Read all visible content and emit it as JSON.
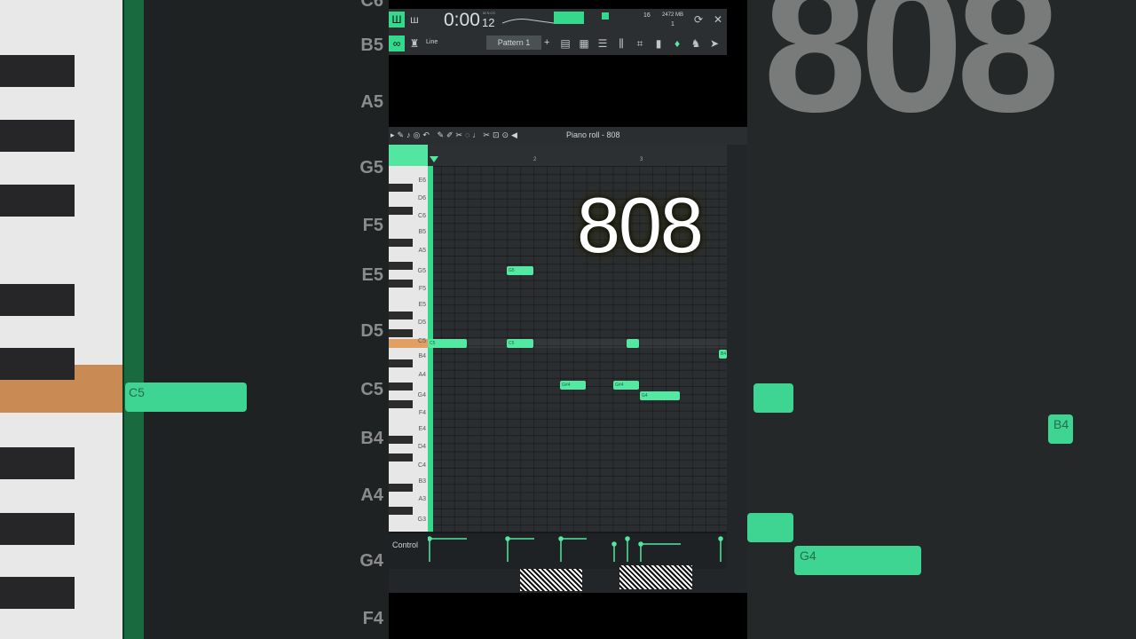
{
  "background_left": {
    "key_labels": [
      "C6",
      "B5",
      "A5",
      "G5",
      "F5",
      "E5",
      "D5",
      "C5",
      "B4",
      "A4",
      "G4",
      "F4"
    ],
    "note_label": "C5"
  },
  "background_right": {
    "big_text": "808",
    "notes": [
      "B4",
      "G4"
    ]
  },
  "topbar": {
    "time": "0:00",
    "time_small": "12",
    "time_unit": "M:S:CS",
    "cpu_value": "16",
    "memory": "2472 MB",
    "poly": "1",
    "pattern_label": "Pattern 1",
    "snap_label": "Line",
    "tool_icons": [
      "mixer-icon",
      "channel-rack-icon",
      "playlist-icon",
      "piano-roll-icon",
      "browser-icon",
      "plugin-icon",
      "microphone-icon",
      "help-icon"
    ]
  },
  "piano_roll": {
    "title": "Piano roll - 808",
    "bar_numbers": [
      "2",
      "3"
    ],
    "key_labels": [
      "E6",
      "D6",
      "C6",
      "B5",
      "A5",
      "G5",
      "F5",
      "E5",
      "D5",
      "C5",
      "B4",
      "A4",
      "G4",
      "F4",
      "E4",
      "D4",
      "C4",
      "B3",
      "A3",
      "G3"
    ],
    "highlighted_key": "C5",
    "notes": [
      {
        "label": "C5"
      },
      {
        "label": "G5"
      },
      {
        "label": "C5"
      },
      {
        "label": "G#4"
      },
      {
        "label": "G#4"
      },
      {
        "label": "G4"
      },
      {
        "label": ""
      },
      {
        "label": "B4"
      }
    ],
    "control_label": "Control"
  },
  "overlay_text": "808",
  "colors": {
    "note_green": "#54e9a2",
    "accent": "#35d98c",
    "highlight_key": "#e0a064"
  }
}
